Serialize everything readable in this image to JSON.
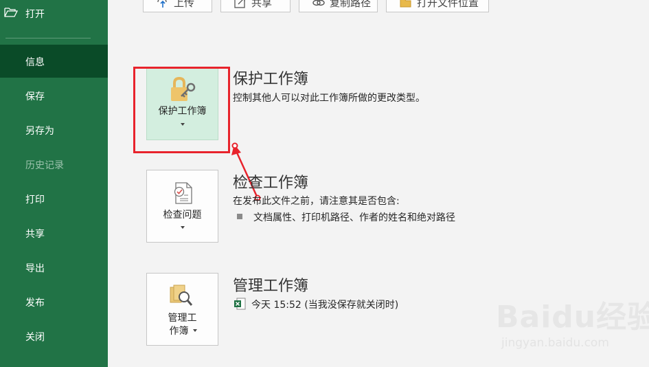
{
  "sidebar": {
    "open_label": "打开",
    "items": [
      {
        "label": "信息",
        "state": "active"
      },
      {
        "label": "保存",
        "state": "normal"
      },
      {
        "label": "另存为",
        "state": "normal"
      },
      {
        "label": "历史记录",
        "state": "disabled"
      },
      {
        "label": "打印",
        "state": "normal"
      },
      {
        "label": "共享",
        "state": "normal"
      },
      {
        "label": "导出",
        "state": "normal"
      },
      {
        "label": "发布",
        "state": "normal"
      },
      {
        "label": "关闭",
        "state": "normal"
      }
    ]
  },
  "toolbar": {
    "upload_label": "上传",
    "share_label": "共享",
    "copy_path_label": "复制路径",
    "open_location_label": "打开文件位置"
  },
  "protect": {
    "tile_label": "保护工作簿",
    "title": "保护工作簿",
    "desc": "控制其他人可以对此工作簿所做的更改类型。"
  },
  "inspect": {
    "tile_label": "检查问题",
    "title": "检查工作簿",
    "desc": "在发布此文件之前，请注意其是否包含:",
    "bullet": "文档属性、打印机路径、作者的姓名和绝对路径"
  },
  "manage": {
    "tile_label_line1": "管理工",
    "tile_label_line2": "作簿",
    "title": "管理工作簿",
    "version_text": "今天 15:52 (当我没保存就关闭时)"
  },
  "watermark": {
    "brand": "Baidu经验",
    "url": "jingyan.baidu.com"
  },
  "colors": {
    "sidebar_bg": "#217346",
    "sidebar_active": "#0a4b28",
    "highlight_red": "#e8232c",
    "tile_selected": "#d3eedf"
  }
}
